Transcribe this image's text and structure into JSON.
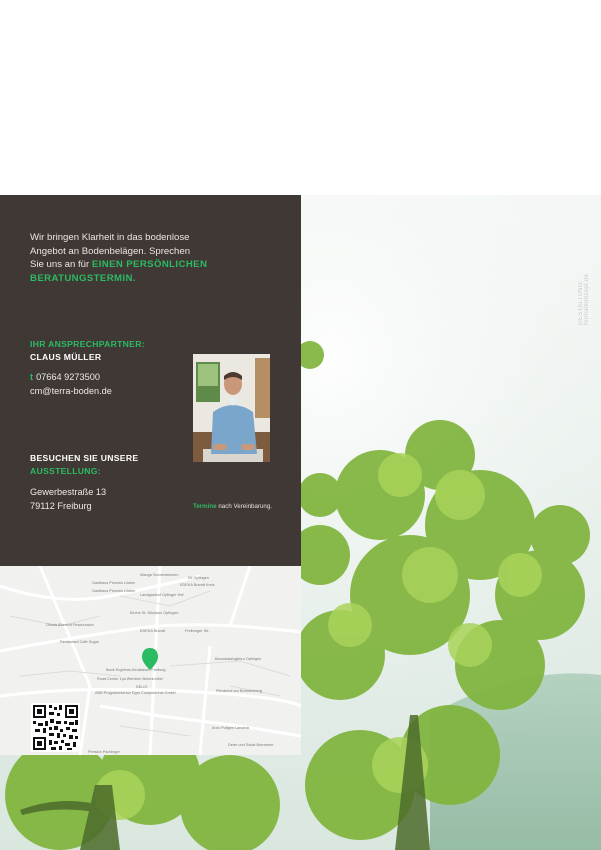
{
  "credit": "GESTALTUNG: formatkonzept.de",
  "intro": {
    "lines": [
      "Wir bringen Klarheit in das bodenlose",
      "Angebot an Bodenbelägen. Sprechen",
      "Sie uns an für "
    ],
    "highlight_1": "EINEN PERSÖNLICHEN",
    "highlight_2": "BERATUNGSTERMIN."
  },
  "contact": {
    "heading": "IHR ANSPRECHPARTNER:",
    "name": "CLAUS MÜLLER",
    "phone_prefix": "t",
    "phone": "07664 9273500",
    "email": "cm@terra-boden.de"
  },
  "visit": {
    "heading_1": "BESUCHEN SIE UNSERE",
    "heading_2": "AUSSTELLUNG:",
    "street": "Gewerbestraße 13",
    "city": "79112 Freiburg",
    "appointment_highlight": "Termine",
    "appointment_rest": " nach Vereinbarung."
  },
  "map": {
    "labels": [
      "Gasthaus Pension Löwen",
      "Elf Opfingen",
      "EDEKA Brandt Kreis",
      "Wanga Sonnenblumen",
      "Gasthaus Pension Löwen",
      "Landgasthof Opfinger Hof",
      "Kirche St. Nikolaus Opfingen",
      "EDEKA Brandt",
      "Olinda Albrecht Friseursalon",
      "Restaurant Café Sugar",
      "Freiburger Str.",
      "Baumkatalogbüro Opfingen",
      "Bank Ergebnis-Kindslawm Freiburg",
      "Road Center 1ça Wemlein Betonmöbel",
      "DELIG",
      "ABB Programmiersor Dgm Computerinst GmbH",
      "Pferdehof am Bramberberg",
      "Arno Putlgen Landeck",
      "Deter und Sokat Bornweier",
      "Pension Pachinger"
    ],
    "accent_color": "#2bbb62"
  },
  "colors": {
    "panel": "#403835",
    "accent": "#2bbb62"
  }
}
